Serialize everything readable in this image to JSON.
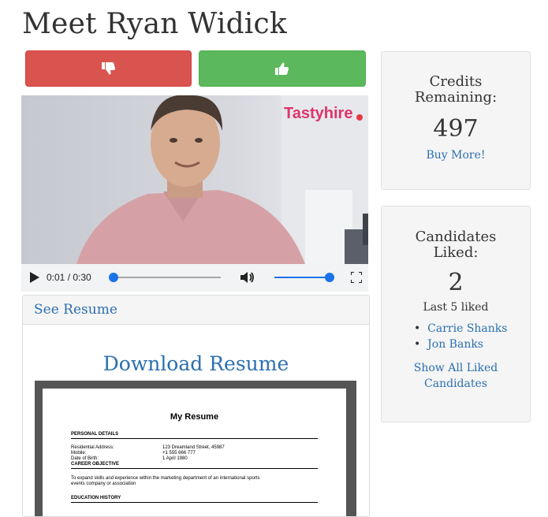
{
  "page": {
    "title": "Meet Ryan Widick"
  },
  "actions": {
    "dislike_icon": "thumbs-down-icon",
    "like_icon": "thumbs-up-icon"
  },
  "video": {
    "watermark": "Tastyhire",
    "current_time": "0:01",
    "duration": "0:30",
    "progress_fraction": 0.03,
    "volume_fraction": 1.0
  },
  "resume_panel": {
    "header_link": "See Resume",
    "download_link": "Download Resume",
    "preview": {
      "title": "My Resume",
      "sections": {
        "personal": "PERSONAL DETAILS",
        "objective": "CAREER OBJECTIVE",
        "education": "EDUCATION HISTORY"
      },
      "rows": [
        {
          "label": "Residential Address:",
          "value": "123 Dreamland Street, 45987"
        },
        {
          "label": "Mobile:",
          "value": "+1 555 666 777"
        },
        {
          "label": "Date of Birth:",
          "value": "1 April 1980"
        }
      ],
      "objective_text_line1": "To expand skills and experience within the marketing department of an international sports",
      "objective_text_line2": "events company or association"
    }
  },
  "credits": {
    "heading_line1": "Credits",
    "heading_line2": "Remaining:",
    "value": "497",
    "buy_link": "Buy More!"
  },
  "liked": {
    "heading_line1": "Candidates",
    "heading_line2": "Liked:",
    "count": "2",
    "subtitle": "Last 5 liked",
    "names": [
      "Carrie Shanks",
      "Jon Banks"
    ],
    "show_all_line1": "Show All Liked",
    "show_all_line2": "Candidates"
  },
  "colors": {
    "danger": "#d9534f",
    "success": "#5cb85c",
    "link": "#2a6fb0",
    "brand_pink": "#e0336a",
    "slider_blue": "#1a73e8"
  }
}
